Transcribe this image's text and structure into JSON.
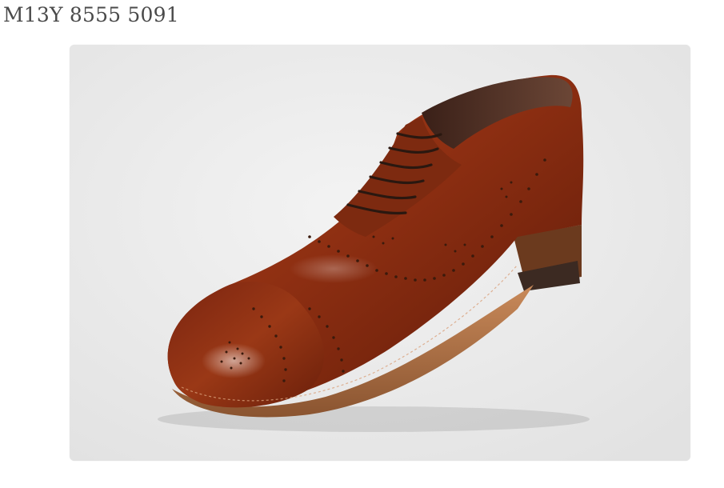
{
  "product": {
    "title": "M13Y 8555 5091"
  },
  "photo": {
    "subject": "shoe-illustration",
    "background_color": "#ececec",
    "leather_color": "#8e2f12"
  }
}
